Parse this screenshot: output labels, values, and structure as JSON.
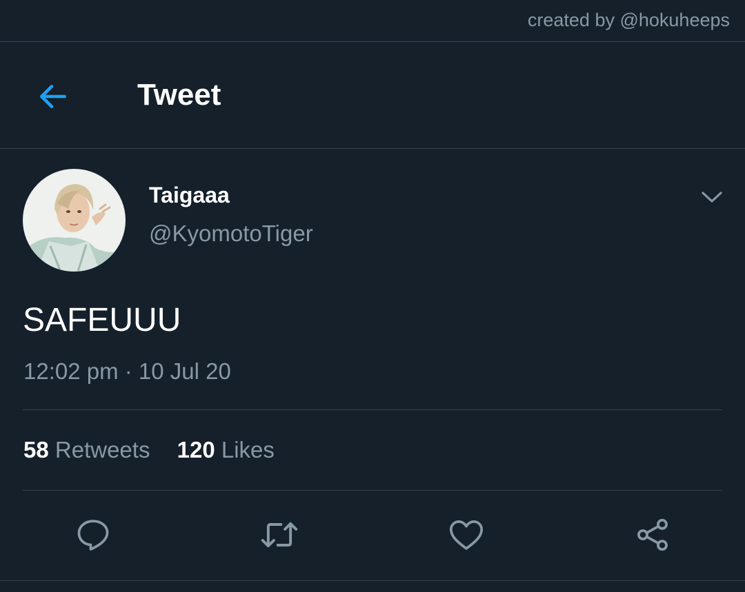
{
  "watermark": {
    "text": "created by @hokuheeps"
  },
  "header": {
    "title": "Tweet",
    "back_icon": "arrow-left-icon"
  },
  "tweet": {
    "author": {
      "display_name": "Taigaaa",
      "handle": "@KyomotoTiger",
      "avatar": "avatar-photo"
    },
    "more_icon": "chevron-down-icon",
    "text": "SAFEUUU",
    "timestamp": "12:02 pm · 10 Jul 20"
  },
  "stats": {
    "retweets": {
      "count": "58",
      "label": "Retweets"
    },
    "likes": {
      "count": "120",
      "label": "Likes"
    }
  },
  "actions": {
    "reply_icon": "reply-icon",
    "retweet_icon": "retweet-icon",
    "like_icon": "heart-icon",
    "share_icon": "share-icon"
  },
  "colors": {
    "background": "#15202b",
    "accent": "#1da1f2",
    "muted_text": "#8899a6",
    "divider": "#38444d",
    "icon": "#8899a6"
  }
}
